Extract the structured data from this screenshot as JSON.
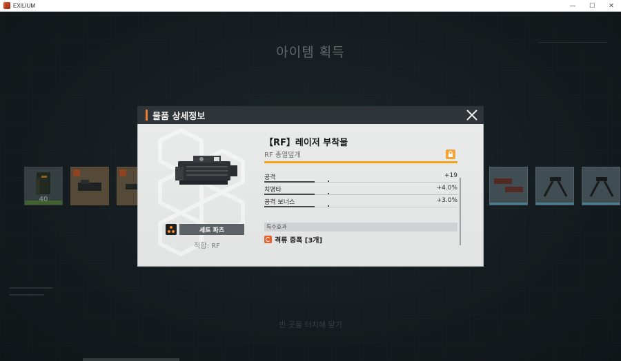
{
  "window": {
    "title": "EXILIUM",
    "minimize_glyph": "—",
    "maximize_glyph": "☐",
    "close_glyph": "✕"
  },
  "background": {
    "title": "아이템 획득",
    "hint_text": "빈 곳을 터치해 닫기",
    "slots": [
      {
        "type": "item",
        "count": "40"
      }
    ]
  },
  "modal": {
    "header_title": "물품 상세정보",
    "item_name": "【RF】레이저 부착물",
    "item_type": "RF 총열덮개",
    "set_label": "세트 파츠",
    "compat_label": "적합: RF",
    "stats": [
      {
        "name": "공격",
        "value": "+19",
        "fill": 0.26
      },
      {
        "name": "치명타",
        "value": "+4.0%",
        "fill": 0.26
      },
      {
        "name": "공격 보너스",
        "value": "+3.0%",
        "fill": 0.26
      }
    ],
    "special_header": "특수효과",
    "special_effect": "격류 증폭 [3개]"
  },
  "colors": {
    "accent_orange": "#ef7d2f",
    "rarity_gold": "#f0a21b",
    "header_dark": "#2e3437",
    "body_light": "#e9eaea"
  },
  "icons": {
    "close": "close-icon",
    "lock": "lock-icon",
    "set": "set-parts-icon",
    "special": "special-effect-icon"
  }
}
